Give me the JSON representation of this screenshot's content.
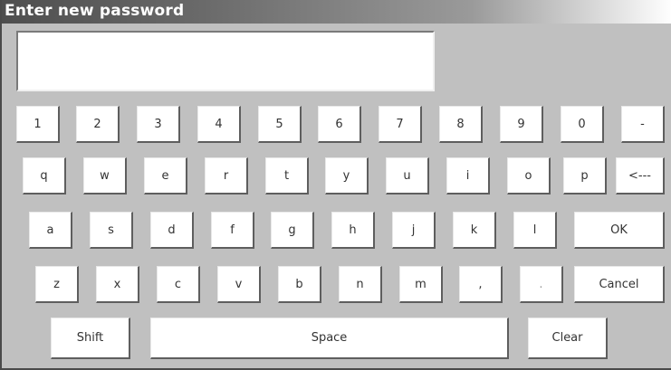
{
  "title": "Enter new password",
  "password_field": {
    "value": ""
  },
  "keys": {
    "row1": [
      "1",
      "2",
      "3",
      "4",
      "5",
      "6",
      "7",
      "8",
      "9",
      "0",
      "-"
    ],
    "row2": [
      "q",
      "w",
      "e",
      "r",
      "t",
      "y",
      "u",
      "i",
      "o",
      "p",
      "<---"
    ],
    "row3": [
      "a",
      "s",
      "d",
      "f",
      "g",
      "h",
      "j",
      "k",
      "l",
      "OK"
    ],
    "row4": [
      "z",
      "x",
      "c",
      "v",
      "b",
      "n",
      "m",
      ",",
      ".",
      "Cancel"
    ],
    "row5": [
      "Shift",
      "Space",
      "Clear"
    ]
  }
}
